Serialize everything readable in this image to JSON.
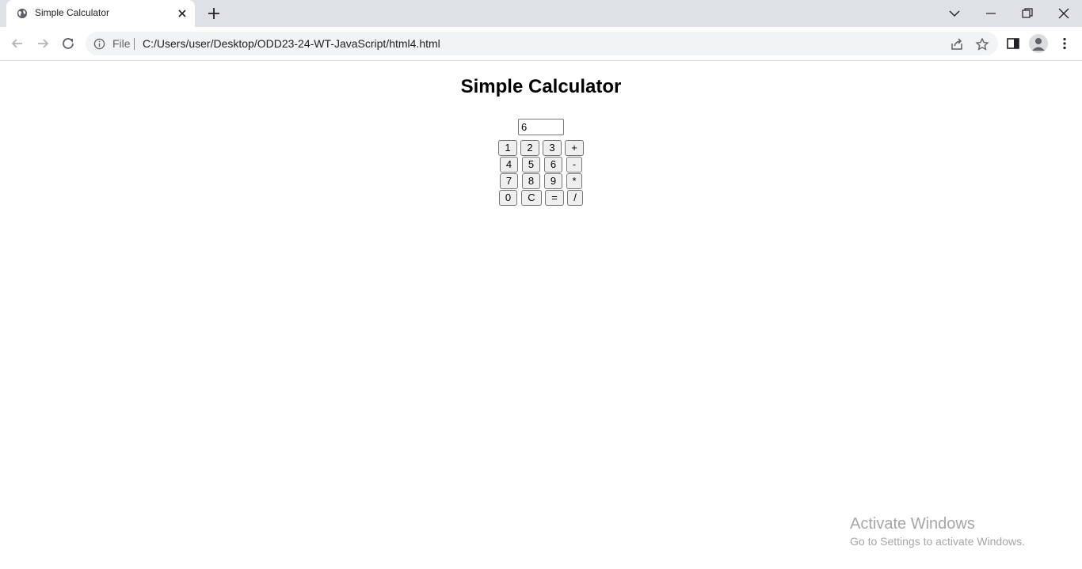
{
  "browser": {
    "tab": {
      "title": "Simple Calculator",
      "favicon": "globe-icon"
    },
    "address_bar": {
      "scheme_chip": "File",
      "url": "C:/Users/user/Desktop/ODD23-24-WT-JavaScript/html4.html"
    },
    "icons": {
      "new_tab": "plus-icon",
      "tab_search": "chevron-down-icon",
      "minimize": "minimize-icon",
      "restore": "restore-icon",
      "close_window": "close-icon",
      "back": "back-arrow-icon",
      "forward": "forward-arrow-icon",
      "reload": "reload-icon",
      "site_info": "info-icon",
      "share": "share-icon",
      "bookmark": "star-icon",
      "side_panel": "side-panel-icon",
      "profile": "avatar-icon",
      "menu": "kebab-menu-icon"
    }
  },
  "page": {
    "heading": "Simple Calculator",
    "display_value": "6",
    "keypad": [
      [
        "1",
        "2",
        "3",
        "+"
      ],
      [
        "4",
        "5",
        "6",
        "-"
      ],
      [
        "7",
        "8",
        "9",
        "*"
      ],
      [
        "0",
        "C",
        "=",
        "/"
      ]
    ]
  },
  "os_overlay": {
    "activation_title": "Activate Windows",
    "activation_subtitle": "Go to Settings to activate Windows."
  }
}
